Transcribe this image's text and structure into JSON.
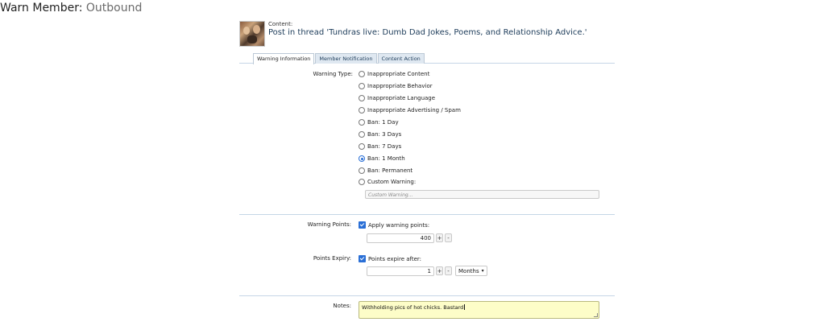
{
  "page": {
    "title_prefix": "Warn Member:",
    "member_name": "Outbound"
  },
  "content": {
    "label": "Content:",
    "link_text": "Post in thread 'Tundras live: Dumb Dad Jokes, Poems, and Relationship Advice.'"
  },
  "tabs": [
    {
      "label": "Warning Information",
      "active": true
    },
    {
      "label": "Member Notification",
      "active": false
    },
    {
      "label": "Content Action",
      "active": false
    }
  ],
  "warning_type": {
    "label": "Warning Type:",
    "options": [
      {
        "label": "Inappropriate Content",
        "checked": false
      },
      {
        "label": "Inappropriate Behavior",
        "checked": false
      },
      {
        "label": "Inappropriate Language",
        "checked": false
      },
      {
        "label": "Inappropriate Advertising / Spam",
        "checked": false
      },
      {
        "label": "Ban: 1 Day",
        "checked": false
      },
      {
        "label": "Ban: 3 Days",
        "checked": false
      },
      {
        "label": "Ban: 7 Days",
        "checked": false
      },
      {
        "label": "Ban: 1 Month",
        "checked": true
      },
      {
        "label": "Ban: Permanent",
        "checked": false
      },
      {
        "label": "Custom Warning:",
        "checked": false
      }
    ],
    "custom_placeholder": "Custom Warning..."
  },
  "warning_points": {
    "label": "Warning Points:",
    "checkbox_label": "Apply warning points:",
    "value": "400",
    "plus": "+",
    "minus": "-"
  },
  "points_expiry": {
    "label": "Points Expiry:",
    "checkbox_label": "Points expire after:",
    "value": "1",
    "plus": "+",
    "minus": "-",
    "unit": "Months"
  },
  "notes": {
    "label": "Notes:",
    "value": "Withholding pics of hot chicks. Bastard"
  },
  "colors": {
    "accent": "#2a6fd6",
    "link": "#1d3c5a",
    "notes_bg": "#fdfdc8"
  }
}
